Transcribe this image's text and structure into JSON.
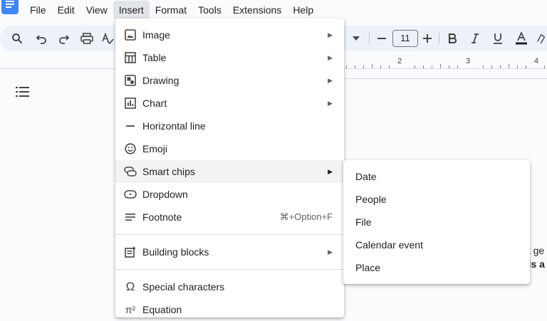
{
  "app": {
    "logo_icon": "google-docs-icon",
    "accent": "#4285f4"
  },
  "menubar": {
    "items": [
      {
        "label": "File"
      },
      {
        "label": "Edit"
      },
      {
        "label": "View"
      },
      {
        "label": "Insert",
        "active": true
      },
      {
        "label": "Format"
      },
      {
        "label": "Tools"
      },
      {
        "label": "Extensions"
      },
      {
        "label": "Help"
      }
    ]
  },
  "toolbar": {
    "font_size": "11",
    "icons": [
      "search-icon",
      "undo-icon",
      "redo-icon",
      "print-icon",
      "spellcheck-icon",
      "chevron-down-icon",
      "minus-icon",
      "plus-icon",
      "bold-icon",
      "italic-icon",
      "underline-icon",
      "text-color-icon",
      "highlight-icon"
    ]
  },
  "ruler": {
    "labels": [
      "2",
      "3",
      "4"
    ]
  },
  "document": {
    "text_line_1": "at ge",
    "text_line_2": "his a"
  },
  "insert_menu": {
    "items": [
      {
        "label": "Image",
        "icon": "image-icon",
        "submenu": true
      },
      {
        "label": "Table",
        "icon": "table-icon",
        "submenu": true
      },
      {
        "label": "Drawing",
        "icon": "drawing-icon",
        "submenu": true
      },
      {
        "label": "Chart",
        "icon": "chart-icon",
        "submenu": true
      },
      {
        "label": "Horizontal line",
        "icon": "horizontal-line-icon",
        "submenu": false
      },
      {
        "label": "Emoji",
        "icon": "emoji-icon",
        "submenu": false
      },
      {
        "label": "Smart chips",
        "icon": "smart-chips-icon",
        "submenu": true,
        "highlighted": true
      },
      {
        "label": "Dropdown",
        "icon": "dropdown-icon",
        "submenu": false
      },
      {
        "label": "Footnote",
        "icon": "footnote-icon",
        "submenu": false,
        "shortcut": "⌘+Option+F"
      },
      {
        "label": "Building blocks",
        "icon": "building-blocks-icon",
        "submenu": true
      },
      {
        "label": "Special characters",
        "icon": "omega-icon",
        "submenu": false
      },
      {
        "label": "Equation",
        "icon": "equation-icon",
        "submenu": false
      }
    ]
  },
  "smart_chips_submenu": {
    "items": [
      {
        "label": "Date"
      },
      {
        "label": "People"
      },
      {
        "label": "File"
      },
      {
        "label": "Calendar event"
      },
      {
        "label": "Place"
      }
    ]
  }
}
